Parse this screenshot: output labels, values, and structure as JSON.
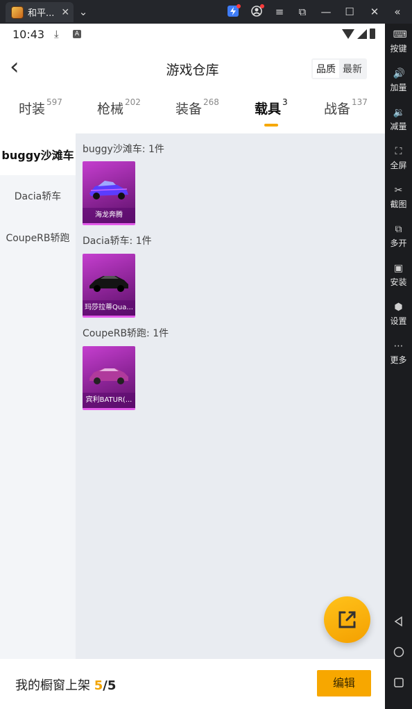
{
  "window": {
    "tab_title": "和平...",
    "tab_close": "✕",
    "menu_chevron": "⌄",
    "controls": [
      "≡",
      "⧉",
      "—",
      "☐",
      "✕",
      "«"
    ]
  },
  "status": {
    "time": "10:43",
    "download_glyph": "⤓",
    "a_badge": "A"
  },
  "header": {
    "back_glyph": "‹",
    "title": "游戏仓库",
    "sort_options": [
      "品质",
      "最新"
    ]
  },
  "categories": [
    {
      "label": "时装",
      "count": "597"
    },
    {
      "label": "枪械",
      "count": "202"
    },
    {
      "label": "装备",
      "count": "268"
    },
    {
      "label": "载具",
      "count": "3"
    },
    {
      "label": "战备",
      "count": "137"
    }
  ],
  "sidebar": {
    "items": [
      "buggy沙滩车",
      "Dacia轿车",
      "CoupeRB轿跑"
    ]
  },
  "groups": [
    {
      "title": "buggy沙滩车: 1件",
      "item": "海龙奔腾",
      "color": "#5b3cff"
    },
    {
      "title": "Dacia轿车: 1件",
      "item": "玛莎拉蒂Qua...",
      "color": "#141414"
    },
    {
      "title": "CoupeRB轿跑: 1件",
      "item": "宾利BATUR(...",
      "color": "#b03a9c"
    }
  ],
  "bottom": {
    "label": "我的橱窗上架",
    "current": "5",
    "total": "/5",
    "edit": "编辑"
  },
  "toolbar": [
    "按键",
    "加量",
    "减量",
    "全屏",
    "截图",
    "多开",
    "安装",
    "设置",
    "更多"
  ],
  "colors": {
    "accent": "#f7a700",
    "card": "#8a2395"
  }
}
